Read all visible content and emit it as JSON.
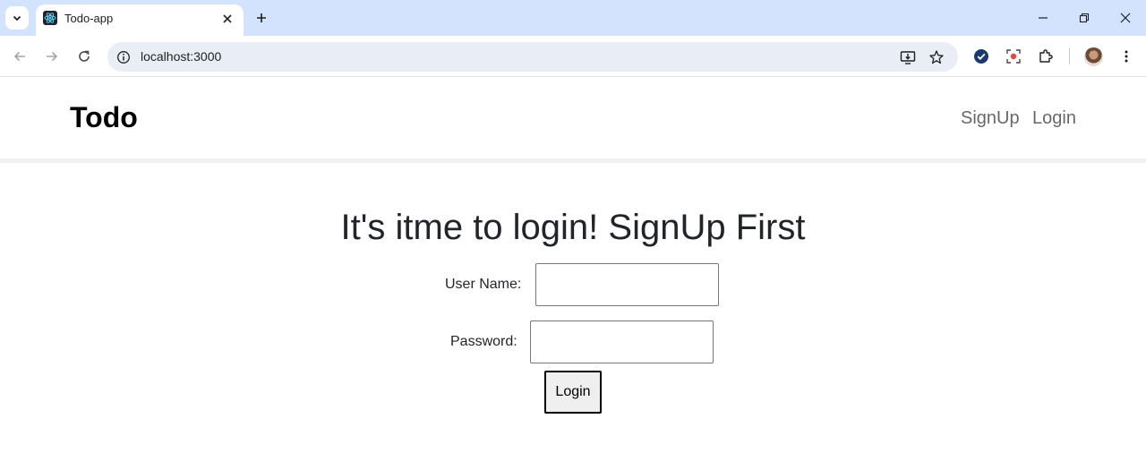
{
  "browser": {
    "tab": {
      "title": "Todo-app"
    },
    "address_bar": {
      "url": "localhost:3000"
    }
  },
  "navbar": {
    "brand": "Todo",
    "links": [
      "SignUp",
      "Login"
    ]
  },
  "main": {
    "heading": "It's itme to login! SignUp First",
    "form": {
      "username_label": "User Name:",
      "username_value": "",
      "password_label": "Password:",
      "password_value": "",
      "submit_label": "Login"
    }
  },
  "colors": {
    "tabstrip": "#d3e3fd",
    "omnibox": "#e9eef6",
    "heading_text": "#212529",
    "nav_link_text": "#666666"
  }
}
